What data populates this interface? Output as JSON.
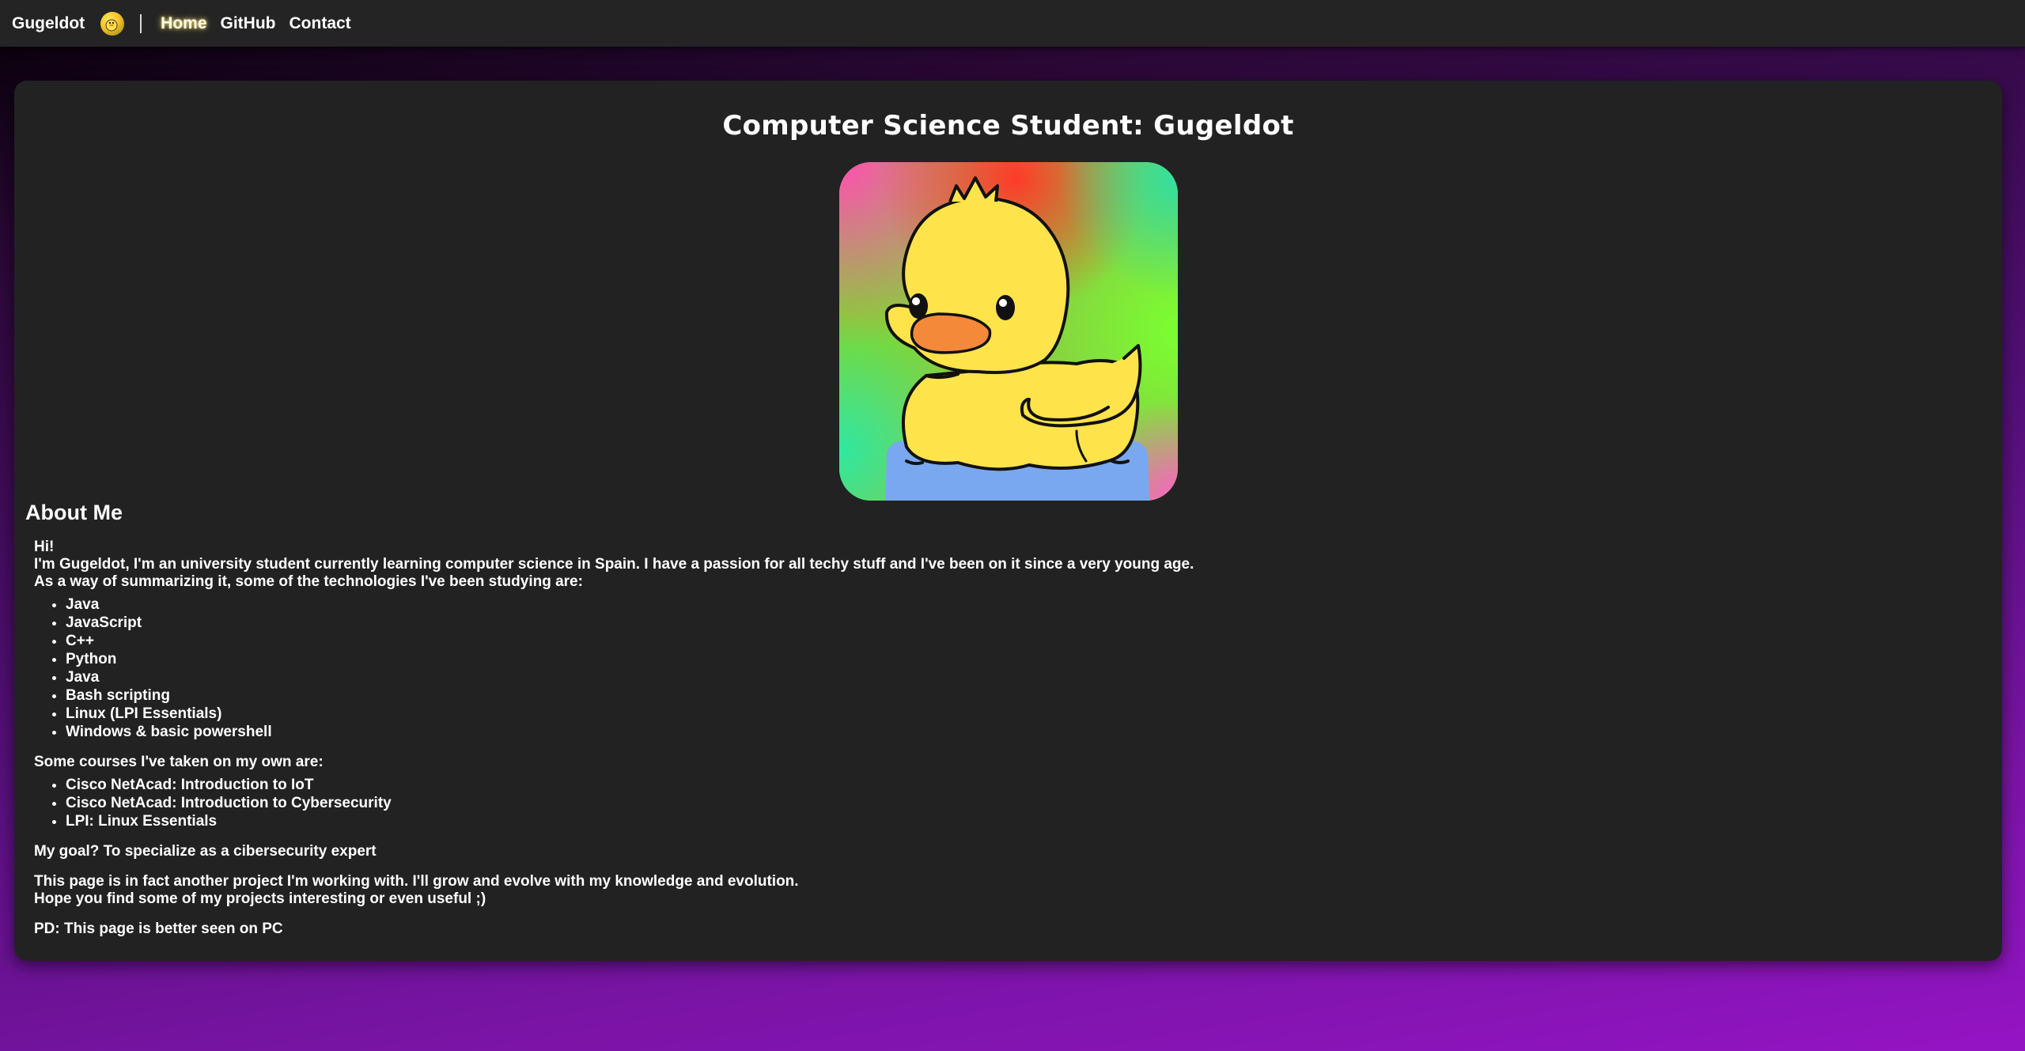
{
  "navbar": {
    "brand": "Gugeldot",
    "links": [
      {
        "label": "Home"
      },
      {
        "label": "GitHub"
      },
      {
        "label": "Contact"
      }
    ]
  },
  "main": {
    "title": "Computer Science Student: Gugeldot",
    "about_heading": "About Me",
    "greeting": "Hi!",
    "intro": "I'm Gugeldot, I'm an university student currently learning computer science in Spain. I have a passion for all techy stuff and I've been on it since a very young age.",
    "tech_intro": "As a way of summarizing it, some of the technologies I've been studying are:",
    "technologies": [
      "Java",
      "JavaScript",
      "C++",
      "Python",
      "Java",
      "Bash scripting",
      "Linux (LPI Essentials)",
      "Windows & basic powershell"
    ],
    "courses_intro": "Some courses I've taken on my own are:",
    "courses": [
      "Cisco NetAcad: Introduction to IoT",
      "Cisco NetAcad: Introduction to Cybersecurity",
      "LPI: Linux Essentials"
    ],
    "goal": "My goal? To specialize as a cibersecurity expert",
    "project_line1": "This page is in fact another project I'm working with. I'll grow and evolve with my knowledge and evolution.",
    "project_line2": "Hope you find some of my projects interesting or even useful ;)",
    "pd": "PD: This page is better seen on PC"
  },
  "colors": {
    "navbar_bg": "#242424",
    "card_bg": "#222222",
    "page_gradient_end": "#9414c4",
    "duck_yellow": "#ffe34a",
    "duck_beak": "#f5893a",
    "water": "#7aa8f0"
  },
  "icons": {
    "brand_logo": "duck-logo-icon",
    "avatar": "duck-avatar-image"
  }
}
